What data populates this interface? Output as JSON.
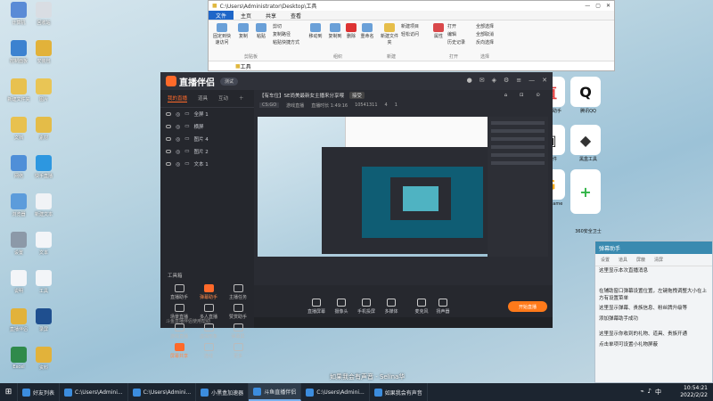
{
  "desktop_icons": [
    {
      "label": "计算机",
      "color": "#5a8bd6"
    },
    {
      "label": "回收站",
      "color": "#d9dde3"
    },
    {
      "label": "控制面板",
      "color": "#3c82d0"
    },
    {
      "label": "安装包",
      "color": "#e2b23a"
    },
    {
      "label": "新建文件夹",
      "color": "#e8c14f"
    },
    {
      "label": "图片",
      "color": "#e9c555"
    },
    {
      "label": "文档",
      "color": "#e8c14f"
    },
    {
      "label": "素材",
      "color": "#e4bc48"
    },
    {
      "label": "网络",
      "color": "#4f8fd8"
    },
    {
      "label": "快手直播",
      "color": "#2d97e0"
    },
    {
      "label": "浏览器",
      "color": "#5c9cdb"
    },
    {
      "label": "新建文本",
      "color": "#f1f3f6"
    },
    {
      "label": "设置",
      "color": "#8c99a8"
    },
    {
      "label": "文本",
      "color": "#f3f5f8"
    },
    {
      "label": "说明",
      "color": "#f3f5f8"
    },
    {
      "label": "工具",
      "color": "#f3f5f8"
    },
    {
      "label": "直播伴侣",
      "color": "#e2b23a"
    },
    {
      "label": "录屏",
      "color": "#1f4f8f"
    },
    {
      "label": "Excel",
      "color": "#2f8a4b"
    },
    {
      "label": "资料",
      "color": "#e2b23a"
    },
    {
      "label": "Word",
      "color": "#2b6cc4"
    },
    {
      "label": "其他",
      "color": "#e2b23a"
    }
  ],
  "explorer": {
    "path": "C:\\Users\\Administrator\\Desktop\\工具",
    "tabs": [
      "文件",
      "主页",
      "共享",
      "查看"
    ],
    "ribbon": {
      "pin": "固定到快速访问",
      "copy": "复制",
      "paste": "粘贴",
      "cut": "剪切",
      "copy_path": "复制路径",
      "paste_shortcut": "粘贴快捷方式",
      "move_to": "移动到",
      "copy_to": "复制到",
      "delete": "删除",
      "rename": "重命名",
      "new_folder": "新建文件夹",
      "new_item": "新建项目",
      "easy_access": "轻松访问",
      "properties": "属性",
      "open": "打开",
      "edit": "编辑",
      "history": "历史记录",
      "select_all": "全部选择",
      "select_none": "全部取消",
      "invert": "反向选择",
      "groups": [
        "剪贴板",
        "组织",
        "新建",
        "打开",
        "选择"
      ]
    },
    "address": "工具"
  },
  "apps_right": [
    {
      "label": "直播助手",
      "glyph": "直",
      "color": "#e23a3a"
    },
    {
      "label": "腾讯QQ",
      "glyph": "Q",
      "color": "#111"
    },
    {
      "label": "软件",
      "glyph": "▣",
      "color": "#222"
    },
    {
      "label": "黑盒工具",
      "glyph": "◆",
      "color": "#333"
    },
    {
      "label": "WeGame",
      "glyph": "G",
      "color": "#f2a81b"
    },
    {
      "label": "360安全卫士",
      "glyph": "+",
      "color": "#2fb344"
    }
  ],
  "app": {
    "title": "直播伴侣",
    "version": "测试",
    "left_tabs": [
      "我的直播",
      "道具",
      "互动",
      "粉丝"
    ],
    "scenes": [
      "全屏 1",
      "横屏",
      "图片 4",
      "图片 2",
      "文本 1"
    ],
    "tools_title": "工具箱",
    "tools": [
      "直播助手",
      "弹幕助手",
      "主播任务",
      "场景直播",
      "多人直播",
      "赞赏助手",
      "游戏直播",
      "虚拟形象",
      "弹幕屏",
      "屏幕共享",
      "连线",
      "更多"
    ],
    "room_title": "【有车位】SE尚美最新女主播来分享喂",
    "room_badge": "接受",
    "row2": [
      "CS:GO",
      "游戏直播",
      "直播时长 1:49:16",
      "10541311",
      "4",
      "1"
    ],
    "bottom_tools": [
      "直播屏幕",
      "摄像头",
      "手机投屏",
      "多媒体",
      "麦克风",
      "扬声器"
    ],
    "go_live": "开始直播",
    "bottom_hint": "斗鱼直播伴侣使用帮助"
  },
  "chat": {
    "header": "弹幕助手",
    "toolbar": [
      "设置",
      "道具",
      "屏蔽",
      "清屏"
    ],
    "messages": [
      "这里显示本次直播消息",
      "在辅助窗口弹幕设置位置，左键拖拽调整大小在上方有设置菜单",
      "这里显示弹幕、贵族信息、粉丝牌升级等",
      "添加弹幕助手成功",
      "这里显示你收到的礼物、道具、贵族开通",
      "点击单项可设置小礼物屏蔽"
    ]
  },
  "subtitle": "如果我会有声音 - Selina华",
  "taskbar": {
    "items": [
      {
        "label": "好友列表",
        "active": false
      },
      {
        "label": "C:\\Users\\Admini...",
        "active": false
      },
      {
        "label": "C:\\Users\\Admini...",
        "active": false
      },
      {
        "label": "小黑盒加速器",
        "active": false
      },
      {
        "label": "斗鱼直播伴侣",
        "active": true
      },
      {
        "label": "C:\\Users\\Admini...",
        "active": false
      },
      {
        "label": "如果我会有声音",
        "active": false
      }
    ],
    "time": "10:54:21",
    "date": "2022/2/22"
  }
}
